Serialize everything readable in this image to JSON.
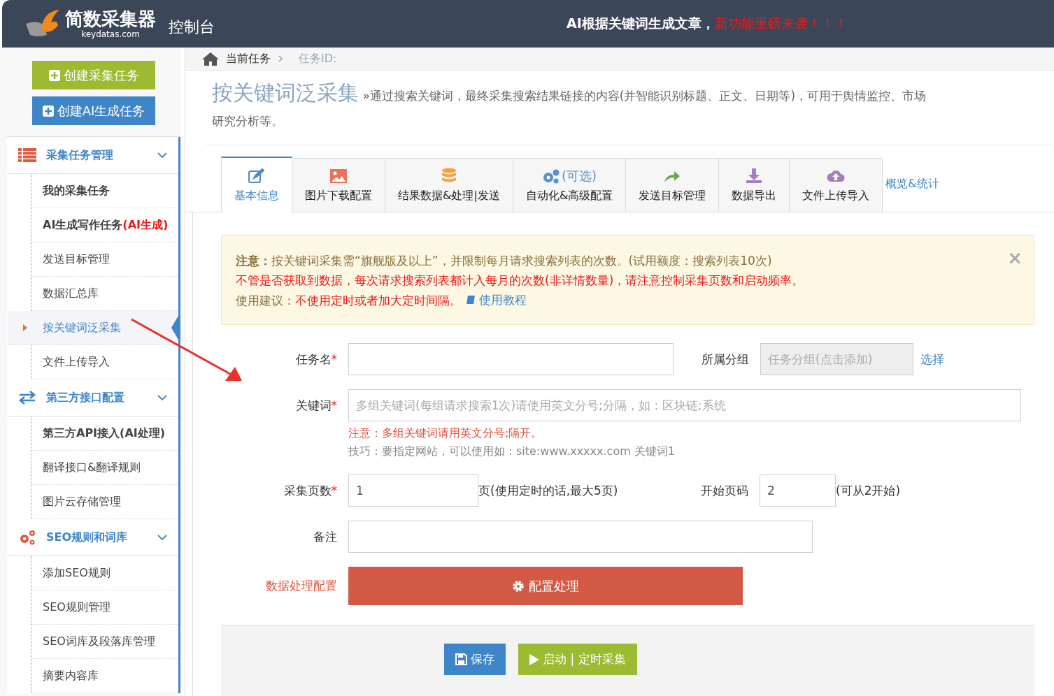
{
  "header": {
    "logo_name": "简数采集器",
    "logo_domain": "keydatas.com",
    "title": "控制台",
    "announcement": "AI根据关键词生成文章，",
    "announcement_highlight": "新功能重磅来袭！！！"
  },
  "sidebar": {
    "buttons": [
      {
        "label": "创建采集任务",
        "kind": "green"
      },
      {
        "label": "创建AI生成任务",
        "kind": "blue"
      }
    ],
    "sections": [
      {
        "title": "采集任务管理",
        "expanded": true,
        "items": [
          {
            "label": "我的采集任务",
            "emphasized": true,
            "selected": false
          },
          {
            "label": "AI生成写作任务",
            "tag": "(AI生成)",
            "emphasized": true,
            "selected": false
          },
          {
            "label": "发送目标管理",
            "emphasized": false,
            "selected": false
          },
          {
            "label": "数据汇总库",
            "emphasized": false,
            "selected": false
          },
          {
            "label": "按关键词泛采集",
            "emphasized": false,
            "selected": true
          },
          {
            "label": "文件上传导入",
            "emphasized": false,
            "selected": false
          }
        ]
      },
      {
        "title": "第三方接口配置",
        "expanded": true,
        "items": [
          {
            "label": "第三方API接入(AI处理)",
            "emphasized": true,
            "selected": false
          },
          {
            "label": "翻译接口&翻译规则",
            "emphasized": false,
            "selected": false
          },
          {
            "label": "图片云存储管理",
            "emphasized": false,
            "selected": false
          }
        ]
      },
      {
        "title": "SEO规则和词库",
        "expanded": true,
        "items": [
          {
            "label": "添加SEO规则",
            "emphasized": false,
            "selected": false
          },
          {
            "label": "SEO规则管理",
            "emphasized": false,
            "selected": false
          },
          {
            "label": "SEO词库及段落库管理",
            "emphasized": false,
            "selected": false
          },
          {
            "label": "摘要内容库",
            "emphasized": false,
            "selected": false
          }
        ]
      }
    ]
  },
  "breadcrumb": [
    "当前任务",
    "任务ID:"
  ],
  "page": {
    "title": "按关键词泛采集",
    "description": "»通过搜索关键词，最终采集搜索结果链接的内容(并智能识别标题、正文、日期等)，可用于舆情监控、市场研究分析等。"
  },
  "tabs": [
    {
      "label": "基本信息",
      "selected": true
    },
    {
      "label": "图片下载配置",
      "selected": false
    },
    {
      "label": "结果数据&处理|发送",
      "selected": false
    },
    {
      "label": "自动化&高级配置",
      "icon_text": "(可选)",
      "selected": false
    },
    {
      "label": "发送目标管理",
      "selected": false
    },
    {
      "label": "数据导出",
      "selected": false
    },
    {
      "label": "文件上传导入",
      "selected": false
    }
  ],
  "tabs_link": "概览&统计",
  "notice": {
    "close": "×",
    "lines": [
      {
        "kind": "normal",
        "text": "**注意：**按关键词采集需“旗舰版及以上”，并限制每月请求搜索列表的次数。(试用额度：搜索列表10次)"
      },
      {
        "kind": "danger",
        "text": "不管是否获取到数据，每次请求搜索列表都计入每月的次数(非详情数量)，请注意控制采集页数和启动频率。"
      },
      {
        "kind": "advice",
        "text": "使用建议：",
        "danger": "不使用定时或者加大定时间隔。",
        "link": "使用教程"
      }
    ]
  },
  "form": {
    "task_name": {
      "label": "任务名",
      "required": "*"
    },
    "group": {
      "label": "所属分组",
      "placeholder": "任务分组(点击添加)",
      "link": "选择"
    },
    "keywords": {
      "label": "关键词",
      "required": "*",
      "placeholder": "多组关键词(每组请求搜索1次)请使用英文分号;分隔，如：区块链;系统",
      "warning": "注意：多组关键词请用英文分号;隔开。",
      "tip": "技巧：要指定网站，可以使用如：site:www.xxxxx.com 关键词1"
    },
    "pages": {
      "label": "采集页数",
      "required": "*",
      "value": "1",
      "suffix": "页(使用定时的话,最大5页)"
    },
    "start_page": {
      "label": "开始页码",
      "value": "2",
      "suffix": "(可从2开始)"
    },
    "remark": {
      "label": "备注"
    },
    "processing": {
      "label": "数据处理配置",
      "button": "配置处理"
    }
  },
  "actions": [
    {
      "label": "保存",
      "kind": "save"
    },
    {
      "label": "启动 | 定时采集",
      "kind": "start"
    }
  ]
}
